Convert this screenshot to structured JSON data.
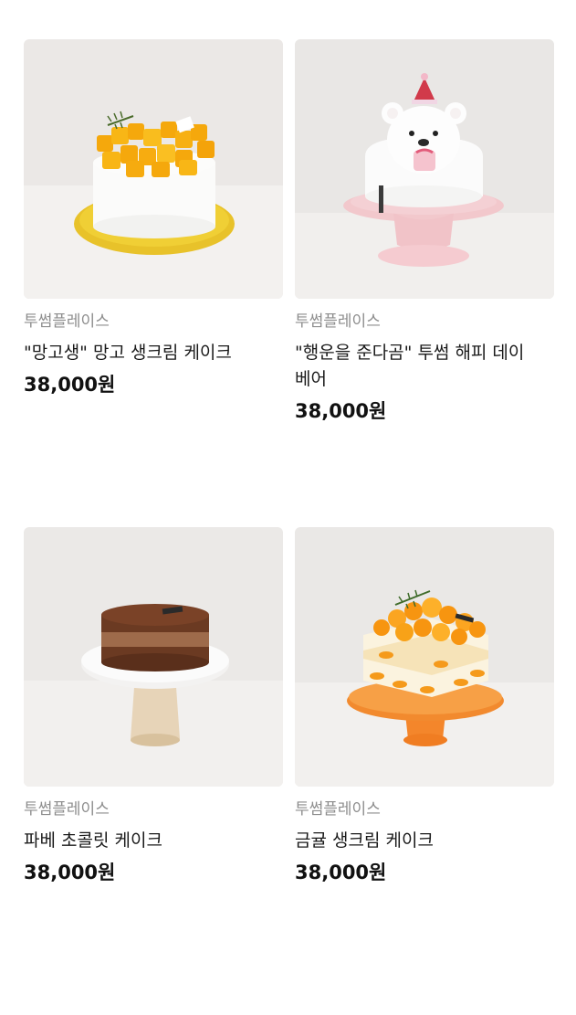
{
  "products": [
    {
      "brand": "투썸플레이스",
      "title": "\"망고생\" 망고 생크림 케이크",
      "price": "38,000원",
      "image": "mango-cake-icon"
    },
    {
      "brand": "투썸플레이스",
      "title": "\"행운을 준다곰\" 투썸 해피 데이 베어",
      "price": "38,000원",
      "image": "bear-cake-icon"
    },
    {
      "brand": "투썸플레이스",
      "title": "파베 초콜릿 케이크",
      "price": "38,000원",
      "image": "chocolate-cake-icon"
    },
    {
      "brand": "투썸플레이스",
      "title": "금귤 생크림 케이크",
      "price": "38,000원",
      "image": "kumquat-cake-icon"
    }
  ],
  "colors": {
    "brand_text": "#8d8d8d",
    "price_text": "#111111",
    "photo_bg": "#ece9e6"
  }
}
